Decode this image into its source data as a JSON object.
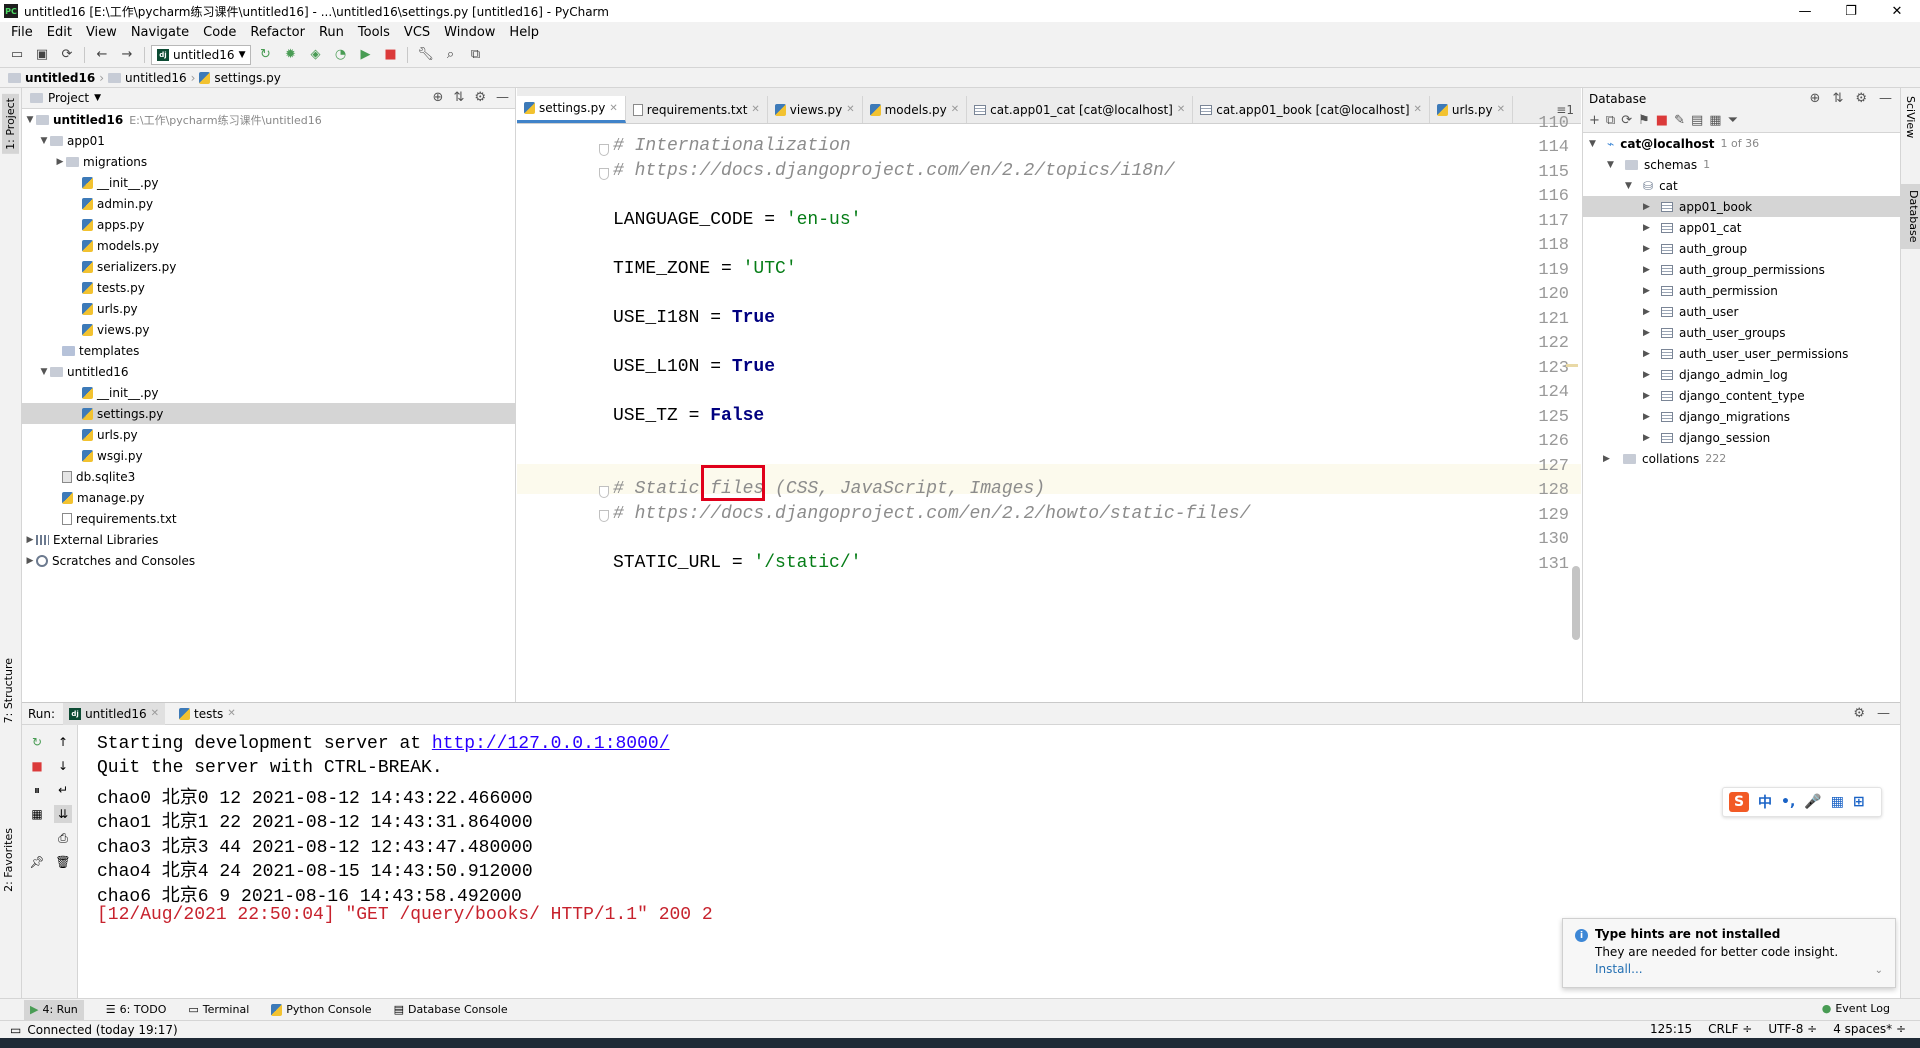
{
  "window": {
    "title": "untitled16 [E:\\工作\\pycharm练习课件\\untitled16] - ...\\untitled16\\settings.py [untitled16] - PyCharm",
    "app_icon": "PC",
    "controls": {
      "minimize": "—",
      "maximize": "❐",
      "close": "✕"
    }
  },
  "menu": [
    "File",
    "Edit",
    "View",
    "Navigate",
    "Code",
    "Refactor",
    "Run",
    "Tools",
    "VCS",
    "Window",
    "Help"
  ],
  "toolbar": {
    "run_config": "untitled16"
  },
  "breadcrumb": [
    "untitled16",
    "untitled16",
    "settings.py"
  ],
  "left_stripe": {
    "project_tab": "1: Project",
    "structure_tab": "7: Structure",
    "favorites_tab": "2: Favorites"
  },
  "right_stripe": {
    "sciview_tab": "SciView",
    "database_tab": "Database"
  },
  "project": {
    "header": "Project",
    "root_name": "untitled16",
    "root_path": "E:\\工作\\pycharm练习课件\\untitled16",
    "items": [
      {
        "label": "app01"
      },
      {
        "label": "migrations"
      },
      {
        "label": "__init__.py"
      },
      {
        "label": "admin.py"
      },
      {
        "label": "apps.py"
      },
      {
        "label": "models.py"
      },
      {
        "label": "serializers.py"
      },
      {
        "label": "tests.py"
      },
      {
        "label": "urls.py"
      },
      {
        "label": "views.py"
      },
      {
        "label": "templates"
      },
      {
        "label": "untitled16"
      },
      {
        "label": "__init__.py"
      },
      {
        "label": "settings.py"
      },
      {
        "label": "urls.py"
      },
      {
        "label": "wsgi.py"
      },
      {
        "label": "db.sqlite3"
      },
      {
        "label": "manage.py"
      },
      {
        "label": "requirements.txt"
      },
      {
        "label": "External Libraries"
      },
      {
        "label": "Scratches and Consoles"
      }
    ]
  },
  "editor": {
    "tabs": [
      "settings.py",
      "requirements.txt",
      "views.py",
      "models.py",
      "cat.app01_cat [cat@localhost]",
      "cat.app01_book [cat@localhost]",
      "urls.py"
    ],
    "tab_overflow": "≡1",
    "lines": [
      {
        "n": "114",
        "code": "# Internationalization"
      },
      {
        "n": "115",
        "code": "# https://docs.djangoproject.com/en/2.2/topics/i18n/"
      },
      {
        "n": "116",
        "code": ""
      },
      {
        "n": "117",
        "code_a": "LANGUAGE_CODE = ",
        "code_b": "'en-us'"
      },
      {
        "n": "118",
        "code": ""
      },
      {
        "n": "119",
        "code_a": "TIME_ZONE = ",
        "code_b": "'UTC'"
      },
      {
        "n": "120",
        "code": ""
      },
      {
        "n": "121",
        "code_a": "USE_I18N = ",
        "code_b": "True"
      },
      {
        "n": "122",
        "code": ""
      },
      {
        "n": "123",
        "code_a": "USE_L10N = ",
        "code_b": "True"
      },
      {
        "n": "124",
        "code": ""
      },
      {
        "n": "125",
        "code_a": "USE_TZ = ",
        "code_b": "False"
      },
      {
        "n": "126",
        "code": ""
      },
      {
        "n": "127",
        "code": ""
      },
      {
        "n": "128",
        "code": "# Static files (CSS, JavaScript, Images)"
      },
      {
        "n": "129",
        "code": "# https://docs.djangoproject.com/en/2.2/howto/static-files/"
      },
      {
        "n": "130",
        "code": ""
      },
      {
        "n": "131",
        "code_a": "STATIC_URL = ",
        "code_b": "'/static/'"
      }
    ]
  },
  "database": {
    "header": "Database",
    "connection": "cat@localhost",
    "connection_count": "1 of 36",
    "schemas_label": "schemas",
    "schemas_count": "1",
    "schema": "cat",
    "tables": [
      "app01_book",
      "app01_cat",
      "auth_group",
      "auth_group_permissions",
      "auth_permission",
      "auth_user",
      "auth_user_groups",
      "auth_user_user_permissions",
      "django_admin_log",
      "django_content_type",
      "django_migrations",
      "django_session"
    ],
    "collations_label": "collations",
    "collations_count": "222"
  },
  "run": {
    "label": "Run:",
    "tabs": [
      "untitled16",
      "tests"
    ],
    "console": {
      "line1_text": "Starting development server at ",
      "line1_link": "http://127.0.0.1:8000/",
      "lines": [
        "Quit the server with CTRL-BREAK.",
        "chao0 北京0 12 2021-08-12 14:43:22.466000",
        "chao1 北京1 22 2021-08-12 14:43:31.864000",
        "chao3 北京3 44 2021-08-12 12:43:47.480000",
        "chao4 北京4 24 2021-08-15 14:43:50.912000",
        "chao6 北京6 9 2021-08-16 14:43:58.492000"
      ],
      "error_line": "[12/Aug/2021 22:50:04] \"GET /query/books/ HTTP/1.1\" 200 2"
    }
  },
  "ime": {
    "logo": "S",
    "items": [
      "中",
      "•,",
      "🎤",
      "▦",
      "⊞"
    ]
  },
  "notification": {
    "title": "Type hints are not installed",
    "body": "They are needed for better code insight.",
    "link": "Install..."
  },
  "bottom_tools": [
    "4: Run",
    "6: TODO",
    "Terminal",
    "Python Console",
    "Database Console"
  ],
  "event_log": "Event Log",
  "status": {
    "left": "Connected (today 19:17)",
    "position": "125:15",
    "line_sep": "CRLF ÷",
    "encoding": "UTF-8 ÷",
    "indent": "4 spaces* ÷"
  }
}
